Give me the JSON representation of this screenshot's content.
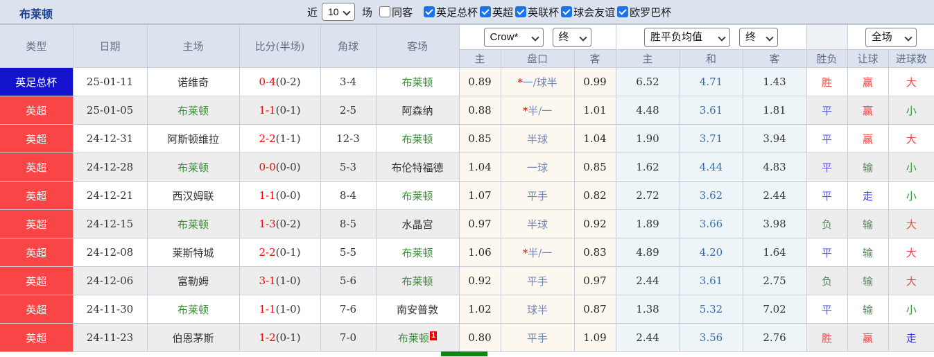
{
  "title": "布莱顿",
  "topbar": {
    "recent_label": "近",
    "recent_value": "10",
    "games_label": "场",
    "same_away": {
      "label": "同客",
      "checked": false
    },
    "competitions": [
      {
        "label": "英足总杯",
        "checked": true
      },
      {
        "label": "英超",
        "checked": true
      },
      {
        "label": "英联杯",
        "checked": true
      },
      {
        "label": "球会友谊",
        "checked": true
      },
      {
        "label": "欧罗巴杯",
        "checked": true
      }
    ]
  },
  "header": {
    "left": [
      "类型",
      "日期",
      "主场",
      "比分(半场)",
      "角球",
      "客场"
    ],
    "asian_group": {
      "company": "Crow*",
      "time": "终"
    },
    "europe_group": {
      "name": "胜平负均值",
      "time": "终"
    },
    "result_group": {
      "period": "全场"
    },
    "sub": [
      "主",
      "盘口",
      "客",
      "主",
      "和",
      "客",
      "胜负",
      "让球",
      "进球数"
    ]
  },
  "rows": [
    {
      "league": "英足总杯",
      "league_color": "league_blue",
      "date": "25-01-11",
      "home": "诺维奇",
      "home_green": false,
      "score": "0-4",
      "half": "(0-2)",
      "corner": "3-4",
      "away": "布莱顿",
      "away_green": true,
      "badge": "",
      "o_home": "0.89",
      "line_star": "*",
      "line": "一/球半",
      "o_away": "0.99",
      "e_home": "6.52",
      "e_draw": "4.71",
      "e_away": "1.43",
      "r_outcome": "胜",
      "r_outcome_color": "result_red",
      "r_handicap": "赢",
      "r_handicap_color": "result_red",
      "r_goals": "大",
      "r_goals_color": "result_red"
    },
    {
      "league": "英超",
      "league_color": "league_red",
      "date": "25-01-05",
      "home": "布莱顿",
      "home_green": true,
      "score": "1-1",
      "half": "(0-1)",
      "corner": "2-5",
      "away": "阿森纳",
      "away_green": false,
      "badge": "",
      "o_home": "0.88",
      "line_star": "*",
      "line": "半/一",
      "o_away": "1.01",
      "e_home": "4.48",
      "e_draw": "3.61",
      "e_away": "1.81",
      "r_outcome": "平",
      "r_outcome_color": "result_blue",
      "r_handicap": "赢",
      "r_handicap_color": "result_red",
      "r_goals": "小",
      "r_goals_color": "bright_green"
    },
    {
      "league": "英超",
      "league_color": "league_red",
      "date": "24-12-31",
      "home": "阿斯顿维拉",
      "home_green": false,
      "score": "2-2",
      "half": "(1-1)",
      "corner": "12-3",
      "away": "布莱顿",
      "away_green": true,
      "badge": "",
      "o_home": "0.85",
      "line_star": "",
      "line": "半球",
      "o_away": "1.04",
      "e_home": "1.90",
      "e_draw": "3.71",
      "e_away": "3.94",
      "r_outcome": "平",
      "r_outcome_color": "result_blue",
      "r_handicap": "赢",
      "r_handicap_color": "result_red",
      "r_goals": "大",
      "r_goals_color": "result_red"
    },
    {
      "league": "英超",
      "league_color": "league_red",
      "date": "24-12-28",
      "home": "布莱顿",
      "home_green": true,
      "score": "0-0",
      "half": "(0-0)",
      "corner": "5-3",
      "away": "布伦特福德",
      "away_green": false,
      "badge": "",
      "o_home": "1.04",
      "line_star": "",
      "line": "一球",
      "o_away": "0.85",
      "e_home": "1.62",
      "e_draw": "4.44",
      "e_away": "4.83",
      "r_outcome": "平",
      "r_outcome_color": "result_blue",
      "r_handicap": "输",
      "r_handicap_color": "result_green",
      "r_goals": "小",
      "r_goals_color": "bright_green"
    },
    {
      "league": "英超",
      "league_color": "league_red",
      "date": "24-12-21",
      "home": "西汉姆联",
      "home_green": false,
      "score": "1-1",
      "half": "(0-0)",
      "corner": "8-4",
      "away": "布莱顿",
      "away_green": true,
      "badge": "",
      "o_home": "1.07",
      "line_star": "",
      "line": "平手",
      "o_away": "0.82",
      "e_home": "2.72",
      "e_draw": "3.62",
      "e_away": "2.44",
      "r_outcome": "平",
      "r_outcome_color": "result_blue",
      "r_handicap": "走",
      "r_handicap_color": "bright_blue",
      "r_goals": "小",
      "r_goals_color": "bright_green"
    },
    {
      "league": "英超",
      "league_color": "league_red",
      "date": "24-12-15",
      "home": "布莱顿",
      "home_green": true,
      "score": "1-3",
      "half": "(0-2)",
      "corner": "8-5",
      "away": "水晶宫",
      "away_green": false,
      "badge": "",
      "o_home": "0.97",
      "line_star": "",
      "line": "半球",
      "o_away": "0.92",
      "e_home": "1.89",
      "e_draw": "3.66",
      "e_away": "3.98",
      "r_outcome": "负",
      "r_outcome_color": "result_green",
      "r_handicap": "输",
      "r_handicap_color": "result_green",
      "r_goals": "大",
      "r_goals_color": "result_red"
    },
    {
      "league": "英超",
      "league_color": "league_red",
      "date": "24-12-08",
      "home": "莱斯特城",
      "home_green": false,
      "score": "2-2",
      "half": "(0-1)",
      "corner": "5-5",
      "away": "布莱顿",
      "away_green": true,
      "badge": "",
      "o_home": "1.06",
      "line_star": "*",
      "line": "半/一",
      "o_away": "0.83",
      "e_home": "4.89",
      "e_draw": "4.20",
      "e_away": "1.64",
      "r_outcome": "平",
      "r_outcome_color": "result_blue",
      "r_handicap": "输",
      "r_handicap_color": "result_green",
      "r_goals": "大",
      "r_goals_color": "result_red"
    },
    {
      "league": "英超",
      "league_color": "league_red",
      "date": "24-12-06",
      "home": "富勒姆",
      "home_green": false,
      "score": "3-1",
      "half": "(1-0)",
      "corner": "5-6",
      "away": "布莱顿",
      "away_green": true,
      "badge": "",
      "o_home": "0.92",
      "line_star": "",
      "line": "平手",
      "o_away": "0.97",
      "e_home": "2.44",
      "e_draw": "3.61",
      "e_away": "2.75",
      "r_outcome": "负",
      "r_outcome_color": "result_green",
      "r_handicap": "输",
      "r_handicap_color": "result_green",
      "r_goals": "大",
      "r_goals_color": "result_red"
    },
    {
      "league": "英超",
      "league_color": "league_red",
      "date": "24-11-30",
      "home": "布莱顿",
      "home_green": true,
      "score": "1-1",
      "half": "(1-0)",
      "corner": "7-6",
      "away": "南安普敦",
      "away_green": false,
      "badge": "",
      "o_home": "1.02",
      "line_star": "",
      "line": "球半",
      "o_away": "0.87",
      "e_home": "1.38",
      "e_draw": "5.32",
      "e_away": "7.02",
      "r_outcome": "平",
      "r_outcome_color": "result_blue",
      "r_handicap": "输",
      "r_handicap_color": "result_green",
      "r_goals": "小",
      "r_goals_color": "bright_green"
    },
    {
      "league": "英超",
      "league_color": "league_red",
      "date": "24-11-23",
      "home": "伯恩茅斯",
      "home_green": false,
      "score": "1-2",
      "half": "(0-1)",
      "corner": "7-0",
      "away": "布莱顿",
      "away_green": true,
      "badge": "1",
      "o_home": "0.80",
      "line_star": "",
      "line": "平手",
      "o_away": "1.09",
      "e_home": "2.44",
      "e_draw": "3.56",
      "e_away": "2.76",
      "r_outcome": "胜",
      "r_outcome_color": "result_red",
      "r_handicap": "赢",
      "r_handicap_color": "result_red",
      "r_goals": "走",
      "r_goals_color": "bright_blue"
    }
  ],
  "colors": {
    "league_blue": "#1313ce",
    "league_red": "#f94545",
    "score_red": "#ff0000",
    "team_green": "#3c8b3c",
    "line_blue": "#7486b4",
    "draw_blue": "#3a6ca6",
    "result_red": "#ef4444",
    "result_blue": "#5c5ce6",
    "result_green": "#56865b",
    "bright_green": "#2f9b2f",
    "bright_blue": "#3b3bf0",
    "badge_red": "#ee0000",
    "checkbox_blue": "#1a73e8",
    "scrollbar_green": "#0a8a0a",
    "header_bg": "#dce3ee",
    "alt_row_bg": "#ededed",
    "asian_col_bg": "#fcf8ef",
    "europe_col_bg": "#edf5f9"
  }
}
